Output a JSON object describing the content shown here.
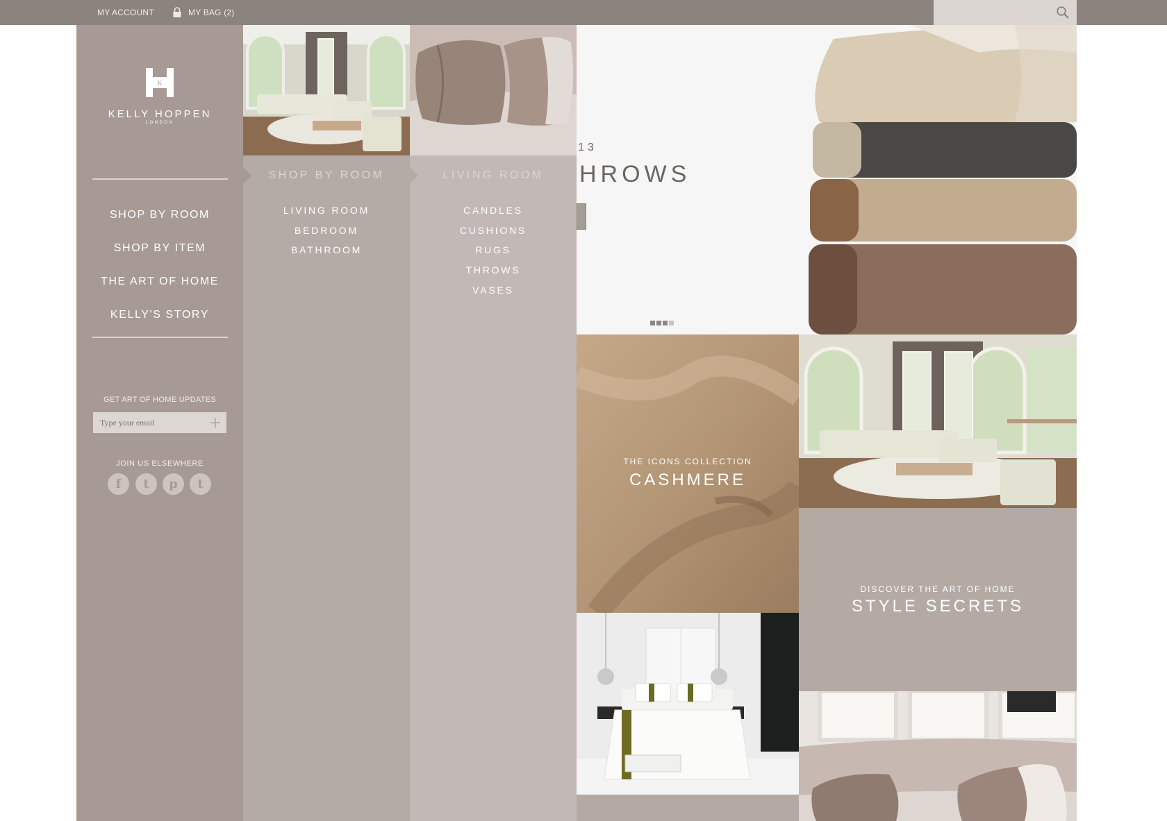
{
  "topbar": {
    "my_account": "MY ACCOUNT",
    "my_bag": "MY BAG (2)",
    "search_placeholder": ""
  },
  "brand": {
    "name": "KELLY HOPPEN",
    "sub": "LONDON",
    "monogram": "K"
  },
  "nav": {
    "items": [
      {
        "label": "SHOP BY ROOM"
      },
      {
        "label": "SHOP BY ITEM"
      },
      {
        "label": "THE ART OF HOME"
      },
      {
        "label": "KELLY'S STORY"
      }
    ]
  },
  "updates": {
    "title": "GET ART OF HOME UPDATES",
    "email_placeholder": "Type your email"
  },
  "social": {
    "title": "JOIN US ELSEWHERE",
    "icons": [
      "facebook-icon",
      "twitter-icon",
      "pinterest-icon",
      "tumblr-icon"
    ],
    "glyphs": [
      "f",
      "t",
      "p",
      "t"
    ]
  },
  "shop_by_room": {
    "title": "SHOP BY ROOM",
    "items": [
      "LIVING ROOM",
      "BEDROOM",
      "BATHROOM"
    ]
  },
  "living_room": {
    "title": "LIVING ROOM",
    "items": [
      "CANDLES",
      "CUSHIONS",
      "RUGS",
      "THROWS",
      "VASES"
    ]
  },
  "hero": {
    "kicker": "13",
    "title": "HROWS",
    "slides_total": 4,
    "slide_active": 3
  },
  "tiles": {
    "cashmere": {
      "kicker": "THE ICONS COLLECTION",
      "title": "CASHMERE"
    },
    "style": {
      "kicker": "DISCOVER THE ART OF HOME",
      "title": "STYLE SECRETS"
    }
  },
  "colors": {
    "topbar": "#8b837e",
    "sidebar": "#a79993",
    "col_room": "#b5aba6",
    "col_living": "#c2b8b5",
    "style_tile": "#b4aaa3"
  }
}
